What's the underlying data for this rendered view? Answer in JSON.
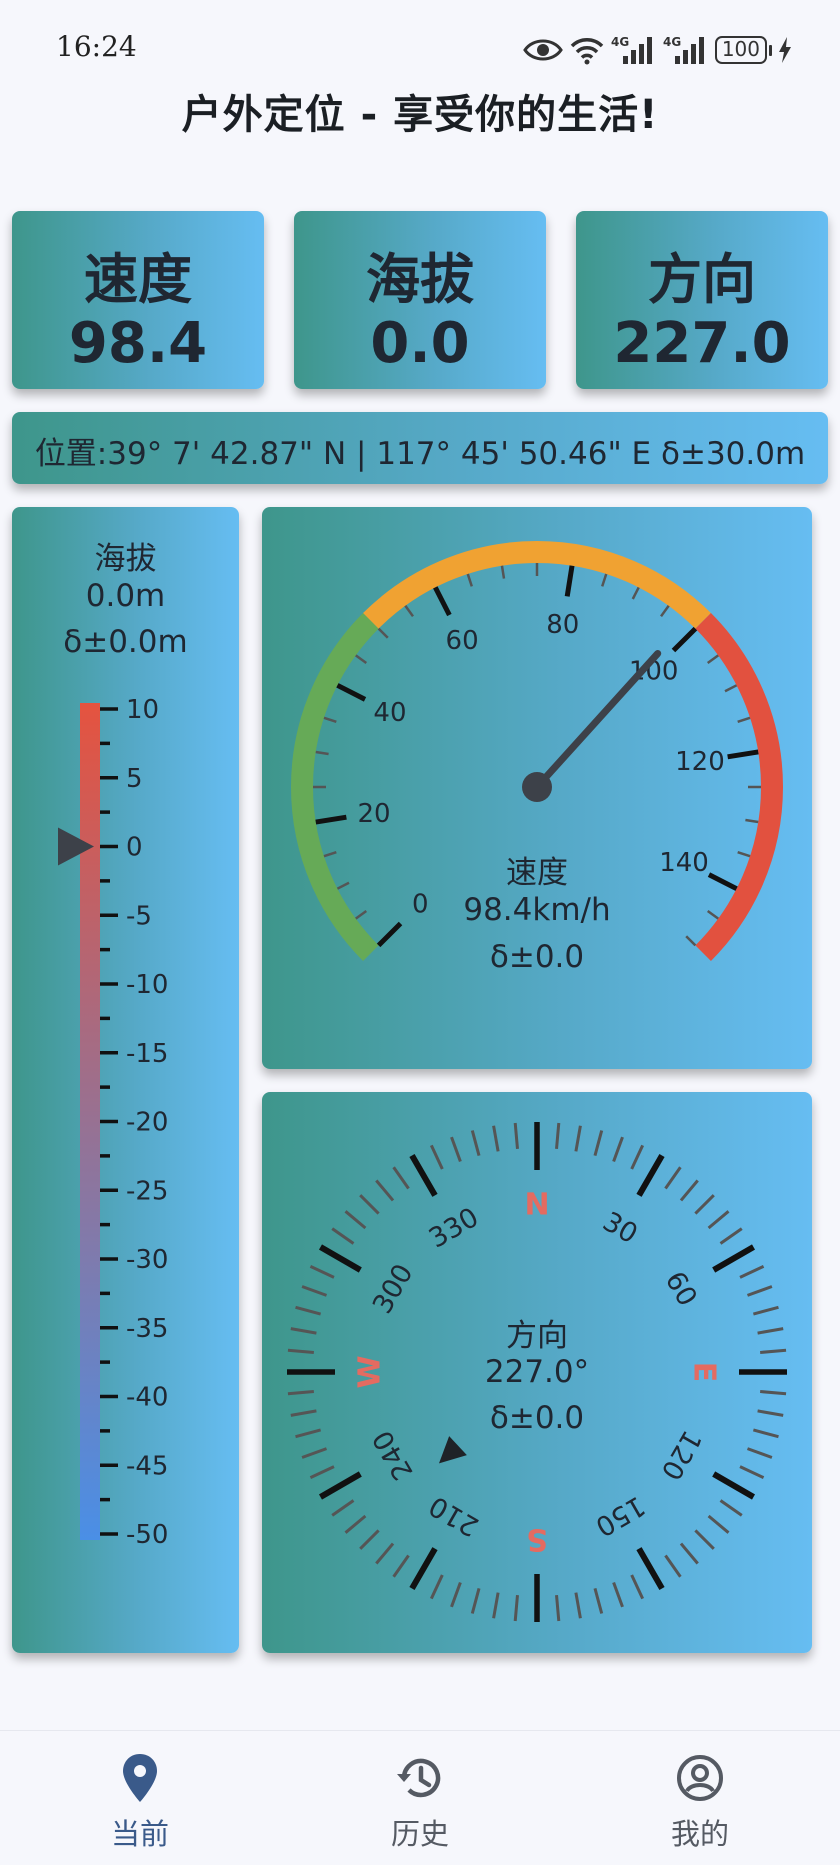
{
  "status_bar": {
    "time": "16:24",
    "network_left": "4G",
    "network_right": "4G",
    "battery": "100",
    "icons": [
      "eye-icon",
      "wifi-icon",
      "signal-4g-icon",
      "signal-4g-icon",
      "battery-icon",
      "charging-bolt-icon"
    ]
  },
  "app": {
    "title": "户外定位 - 享受你的生活!"
  },
  "stats": [
    {
      "label": "速度",
      "value": "98.4"
    },
    {
      "label": "海拔",
      "value": "0.0"
    },
    {
      "label": "方向",
      "value": "227.0"
    }
  ],
  "location": {
    "text": "位置:39° 7' 42.87\" N | 117° 45' 50.46\" E  δ±30.0m"
  },
  "altitude_panel": {
    "title": "海拔",
    "value": "0.0m",
    "accuracy": "δ±0.0m",
    "scale_labels": [
      "10",
      "5",
      "0",
      "-5",
      "-10",
      "-15",
      "-20",
      "-25",
      "-30",
      "-35",
      "-40",
      "-45",
      "-50"
    ],
    "scale_min": -50,
    "scale_max": 10,
    "current": 0.0,
    "colors": {
      "top": "#e5533f",
      "bottom": "#4a8fe6",
      "pointer": "#3d4149"
    }
  },
  "speed_gauge": {
    "title": "速度",
    "value": "98.4km/h",
    "accuracy": "δ±0.0",
    "tick_labels": [
      "0",
      "20",
      "40",
      "60",
      "80",
      "100",
      "120",
      "140"
    ],
    "min": 0,
    "max": 150,
    "current": 98.4,
    "colors": {
      "low": "#66aa57",
      "mid": "#f0a232",
      "high": "#e2513f",
      "needle": "#3d4149"
    }
  },
  "compass": {
    "title": "方向",
    "value": "227.0°",
    "accuracy": "δ±0.0",
    "cardinals": [
      "N",
      "E",
      "S",
      "W"
    ],
    "degree_labels": [
      "30",
      "60",
      "120",
      "150",
      "210",
      "240",
      "300",
      "330"
    ],
    "heading": 227.0,
    "colors": {
      "cardinal": "#e46b61",
      "pointer": "#1f2328"
    }
  },
  "nav": {
    "items": [
      {
        "label": "当前",
        "icon": "location-pin-icon",
        "active": true
      },
      {
        "label": "历史",
        "icon": "history-icon",
        "active": false
      },
      {
        "label": "我的",
        "icon": "profile-icon",
        "active": false
      }
    ],
    "active_color": "#3a5a8a",
    "inactive_color": "#555a63"
  }
}
